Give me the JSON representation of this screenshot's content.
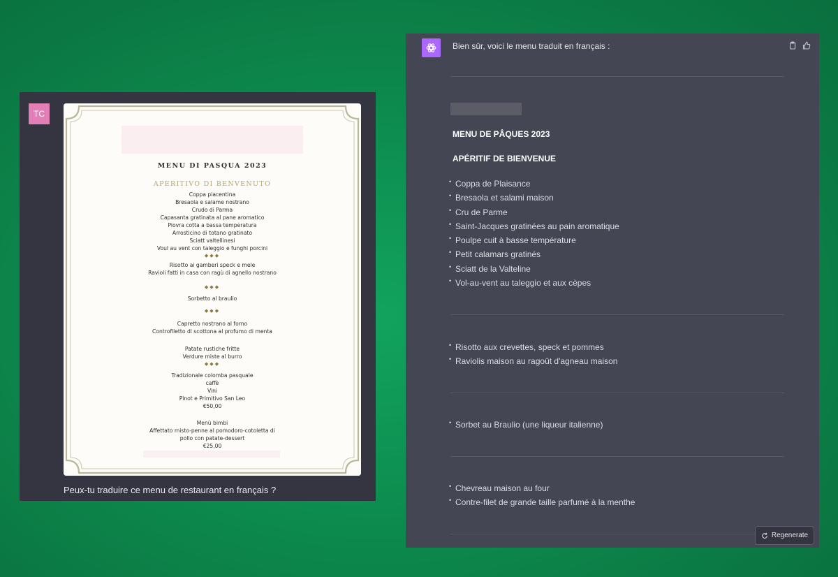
{
  "user": {
    "avatar_initials": "TC",
    "avatar_color": "#e27fb6",
    "caption": "Peux-tu traduire ce menu de restaurant en français ?",
    "menu_image": {
      "title": "MENU DI PASQUA 2023",
      "subtitle": "APERITIVO DI BENVENUTO",
      "block1": [
        "Coppa piacentina",
        "Bresaola e salame nostrano",
        "Crudo di Parma",
        "Capasanta gratinata al pane aromatico",
        "Piovra cotta a bassa temperatura",
        "Arrosticino di totano gratinato",
        "Sciatt valtellinesi",
        "Voul au vent con taleggio e funghi porcini"
      ],
      "diamonds": "◆◆◆",
      "block2": [
        "Risotto ai gamberi speck e mele",
        "Ravioli fatti in casa con ragù di agnello nostrano"
      ],
      "block3": [
        "Sorbetto al braulio"
      ],
      "block4": [
        "Capretto nostrano al forno",
        "Controfiletto di scottona al profumo di menta"
      ],
      "block5": [
        "Patate rustiche fritte",
        "Verdure miste al burro"
      ],
      "block6": [
        "Tradizionale colomba pasquale",
        "caffè",
        "Vini",
        "Pinot e Primitivo San Leo",
        "€50,00"
      ],
      "block7": [
        "Menù bimbi",
        "Affettato misto-penne al pomodoro-cotoletta di",
        "pollo con patate-dessert",
        "€25,00"
      ]
    }
  },
  "assistant": {
    "avatar_color": "#ab68ff",
    "intro": "Bien sûr, voici le menu traduit en français :",
    "heading_menu": "MENU DE PÂQUES 2023",
    "heading_aperitif": "APÉRITIF DE BIENVENUE",
    "list1": [
      "Coppa de Plaisance",
      "Bresaola et salami maison",
      "Cru de Parme",
      "Saint-Jacques gratinées au pain aromatique",
      "Poulpe cuit à basse température",
      "Petit calamars gratinés",
      "Sciatt de la Valteline",
      "Vol-au-vent au taleggio et aux cèpes"
    ],
    "list2": [
      "Risotto aux crevettes, speck et pommes",
      "Raviolis maison au ragoût d'agneau maison"
    ],
    "list3": [
      "Sorbet au Braulio (une liqueur italienne)"
    ],
    "list4": [
      "Chevreau maison au four",
      "Contre-filet de grande taille parfumé à la menthe"
    ],
    "regenerate_label": "Regenerate"
  }
}
